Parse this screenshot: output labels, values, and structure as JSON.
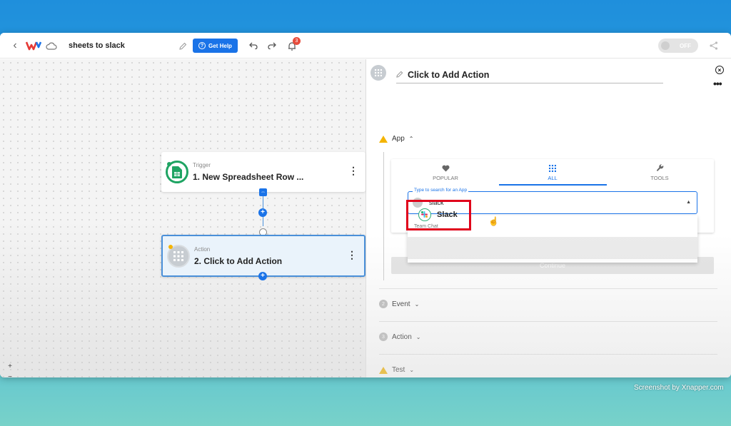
{
  "app": {
    "flow_name": "sheets to slack",
    "get_help_label": "Get Help",
    "notification_count": "3",
    "toggle_label": "OFF",
    "brand_color": "#1a73e8"
  },
  "canvas": {
    "nodes": [
      {
        "type": "Trigger",
        "title": "1. New Spreadsheet Row ...",
        "icon": "google-sheets-icon"
      },
      {
        "type": "Action",
        "title": "2. Click to Add Action",
        "icon": "app-grid-icon"
      }
    ],
    "zoom_controls": [
      "+",
      "−",
      "⛶",
      "🔒"
    ]
  },
  "panel": {
    "title": "Click to Add Action",
    "sections": [
      {
        "num": "",
        "label": "App",
        "status": "warning",
        "expanded": true
      },
      {
        "num": "2",
        "label": "Event"
      },
      {
        "num": "3",
        "label": "Action"
      },
      {
        "num": "",
        "label": "Test",
        "status": "warning"
      }
    ],
    "tabs": [
      {
        "label": "POPULAR",
        "icon": "heart-icon"
      },
      {
        "label": "ALL",
        "icon": "grid-icon",
        "active": true
      },
      {
        "label": "TOOLS",
        "icon": "wrench-icon"
      }
    ],
    "search": {
      "label": "Type to search for an App",
      "value": "slack"
    },
    "dropdown": {
      "group": "Team Chat",
      "option": "Slack"
    },
    "continue_label": "Continue"
  },
  "watermark": "Screenshot by Xnapper.com"
}
